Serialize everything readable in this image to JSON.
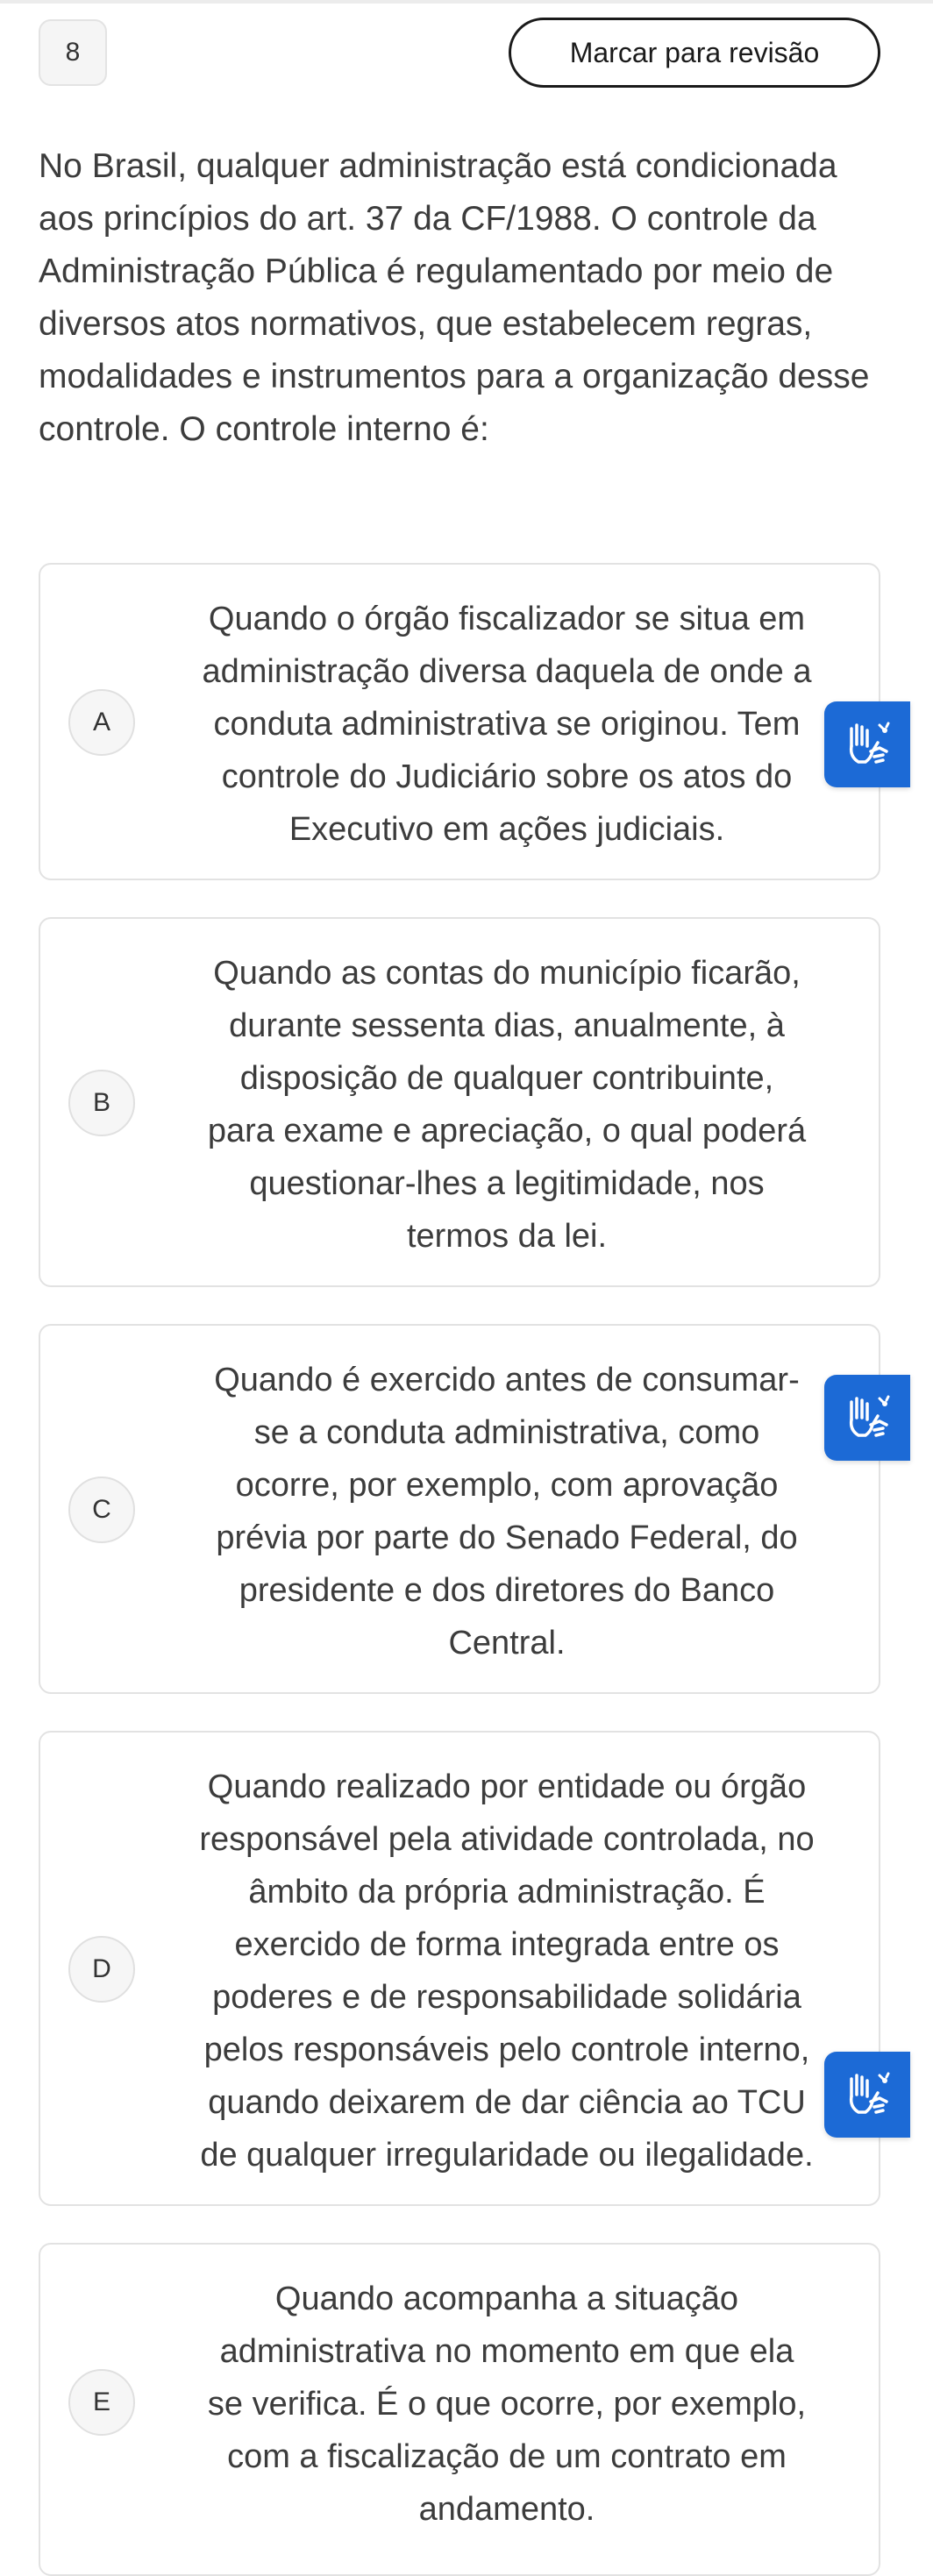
{
  "question": {
    "number": "8",
    "review_label": "Marcar para revisão",
    "text": "No Brasil, qualquer administração está condicionada aos princípios do art. 37 da CF/1988. O controle da Administração Pública é regulamentado por meio de diversos atos normativos, que estabelecem regras, modalidades e instrumentos para a organização desse controle. O controle interno é:"
  },
  "options": [
    {
      "letter": "A",
      "text": "Quando o órgão fiscalizador se situa em\nadministração diversa daquela de onde a\nconduta administrativa se originou. Tem\ncontrole do Judiciário sobre os atos do\nExecutivo em ações judiciais."
    },
    {
      "letter": "B",
      "text": "Quando as contas do município ficarão,\ndurante sessenta dias, anualmente, à\ndisposição de qualquer contribuinte,\npara exame e apreciação, o qual poderá\nquestionar-lhes a legitimidade, nos\ntermos da lei."
    },
    {
      "letter": "C",
      "text": "Quando é exercido antes de consumar-\nse a conduta administrativa, como\nocorre, por exemplo, com aprovação\nprévia por parte do Senado Federal, do\npresidente e dos diretores do Banco\nCentral."
    },
    {
      "letter": "D",
      "text": "Quando realizado por entidade ou órgão\nresponsável pela atividade controlada, no\nâmbito da própria administração. É\nexercido de forma integrada entre os\npoderes e de responsabilidade solidária\npelos responsáveis pelo controle interno,\nquando deixarem de dar ciência ao TCU\nde qualquer irregularidade ou ilegalidade."
    },
    {
      "letter": "E",
      "text": "Quando acompanha a situação\nadministrativa no momento em que ela\nse verifica. É o que ocorre, por exemplo,\ncom a fiscalização de um contrato em\nandamento."
    }
  ],
  "widgets": {
    "accessibility_icon": "sign-language-hands-icon",
    "accessibility_color": "#1c6ad6"
  }
}
